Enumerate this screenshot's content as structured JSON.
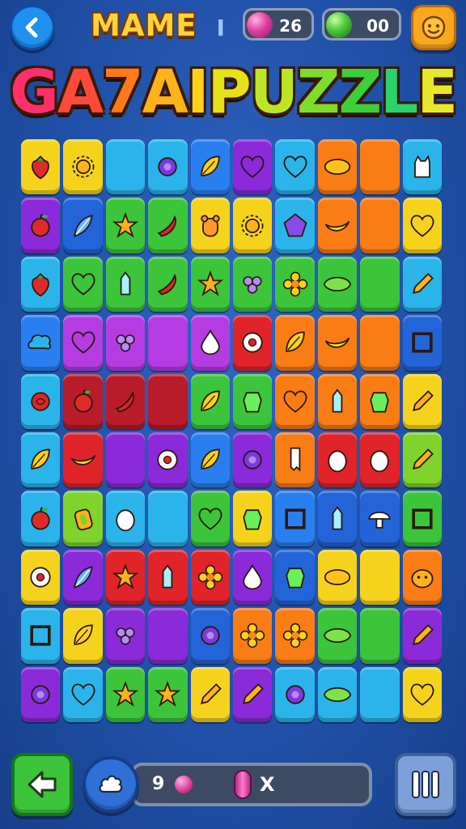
{
  "header": {
    "title": "MAME",
    "title_separator": "I",
    "logo_text": "GA7AIPUZZLE",
    "logo_colors": [
      "#ff2f6a",
      "#ff4a3a",
      "#ff7a1a",
      "#ffb21a",
      "#ffd11a",
      "#e6e21a",
      "#bce624",
      "#7fdc2a",
      "#3ccf3a",
      "#2bd16b",
      "#e8e82a"
    ],
    "counter_pink": {
      "value": "26",
      "gem_color": "#e040a0"
    },
    "counter_green": {
      "value": "00",
      "gem_color": "#4cc63a"
    },
    "icons": {
      "back": "back-arrow-icon",
      "face": "smiley-face-icon"
    }
  },
  "board": {
    "tiles": [
      [
        "#f5d31c",
        "#f5d31c",
        "#2ab4ea",
        "#2ab4ea",
        "#2a7ff0",
        "#8b2ad9",
        "#2ab4ea",
        "#f97c15",
        "#f97c15",
        "#2ab4ea"
      ],
      [
        "#8b2ad9",
        "#2364d8",
        "#3cc43a",
        "#3cc43a",
        "#f5d31c",
        "#f5d31c",
        "#2ab4ea",
        "#f97c15",
        "#f97c15",
        "#f5d31c"
      ],
      [
        "#2ab4ea",
        "#3cc43a",
        "#3cc43a",
        "#3cc43a",
        "#3cc43a",
        "#3cc43a",
        "#3cc43a",
        "#3cc43a",
        "#3cc43a",
        "#2ab4ea"
      ],
      [
        "#2a7ff0",
        "#b53ce2",
        "#b53ce2",
        "#b53ce2",
        "#b53ce2",
        "#e0242a",
        "#f97c15",
        "#f97c15",
        "#f97c15",
        "#2364d8"
      ],
      [
        "#2ab4ea",
        "#b81b2a",
        "#b81b2a",
        "#b81b2a",
        "#3cc43a",
        "#3cc43a",
        "#f97c15",
        "#f97c15",
        "#f97c15",
        "#f5d31c"
      ],
      [
        "#2ab4ea",
        "#e0242a",
        "#8b2ad9",
        "#8b2ad9",
        "#2a7ff0",
        "#8b2ad9",
        "#f97c15",
        "#e0242a",
        "#e0242a",
        "#7fd32a"
      ],
      [
        "#2ab4ea",
        "#7fd32a",
        "#2ab4ea",
        "#2ab4ea",
        "#3cc43a",
        "#f5d31c",
        "#2a7ff0",
        "#2364d8",
        "#2364d8",
        "#3cc43a"
      ],
      [
        "#f5d31c",
        "#8b2ad9",
        "#e0242a",
        "#e0242a",
        "#e0242a",
        "#8b2ad9",
        "#2364d8",
        "#f5d31c",
        "#f5d31c",
        "#f97c15"
      ],
      [
        "#2ab4ea",
        "#f5d31c",
        "#8b2ad9",
        "#8b2ad9",
        "#2364d8",
        "#f97c15",
        "#f97c15",
        "#3cc43a",
        "#3cc43a",
        "#8b2ad9"
      ],
      [
        "#8b2ad9",
        "#2ab4ea",
        "#3cc43a",
        "#3cc43a",
        "#f5d31c",
        "#8b2ad9",
        "#2ab4ea",
        "#2ab4ea",
        "#2ab4ea",
        "#f5d31c"
      ]
    ],
    "icons": [
      [
        "strawberry-icon",
        "sun-icon",
        "none",
        "berry-icon",
        "leaf-icon",
        "heart-icon",
        "heart-icon",
        "mango-icon",
        "none",
        "cat-icon"
      ],
      [
        "apple-icon",
        "feather-icon",
        "star-icon",
        "chili-icon",
        "bear-icon",
        "sun-icon",
        "pentagon-icon",
        "banana-icon",
        "none",
        "heart-icon"
      ],
      [
        "strawberry-icon",
        "heart-icon",
        "crystal-icon",
        "chili-icon",
        "star-icon",
        "grapes-icon",
        "flower-icon",
        "pea-pod-icon",
        "none",
        "pencil-icon"
      ],
      [
        "cloud-icon",
        "heart-icon",
        "grapes-icon",
        "none",
        "drop-icon",
        "donut-icon",
        "leaf-icon",
        "banana-icon",
        "none",
        "square-icon"
      ],
      [
        "rose-icon",
        "apple-icon",
        "chili-icon",
        "none",
        "leaf-icon",
        "gem-icon",
        "heart-icon",
        "crystal-icon",
        "gem-icon",
        "pencil-icon"
      ],
      [
        "leaf-icon",
        "banana-icon",
        "none",
        "donut-icon",
        "leaf-icon",
        "berry-icon",
        "bone-icon",
        "egg-icon",
        "egg-icon",
        "pencil-icon"
      ],
      [
        "apple-icon",
        "ring-icon",
        "egg-icon",
        "none",
        "heart-icon",
        "gem-icon",
        "square-icon",
        "crystal-icon",
        "mushroom-icon",
        "square-icon"
      ],
      [
        "donut-icon",
        "feather-icon",
        "star-icon",
        "crystal-icon",
        "flower-icon",
        "drop-icon",
        "gem-icon",
        "mango-icon",
        "none",
        "pumpkin-icon"
      ],
      [
        "square-icon",
        "leaf-icon",
        "grapes-icon",
        "none",
        "berry-icon",
        "flower-icon",
        "flower-icon",
        "pea-pod-icon",
        "none",
        "pencil-icon"
      ],
      [
        "berry-icon",
        "heart-icon",
        "star-icon",
        "star-icon",
        "pencil-icon",
        "pencil-icon",
        "berry-icon",
        "pea-pod-icon",
        "none",
        "heart-icon"
      ]
    ]
  },
  "footer": {
    "count": "9",
    "x_label": "X",
    "icons": {
      "back": "back-arrow-icon",
      "hint": "cloud-hint-icon",
      "pause": "pause-bars-icon"
    }
  }
}
